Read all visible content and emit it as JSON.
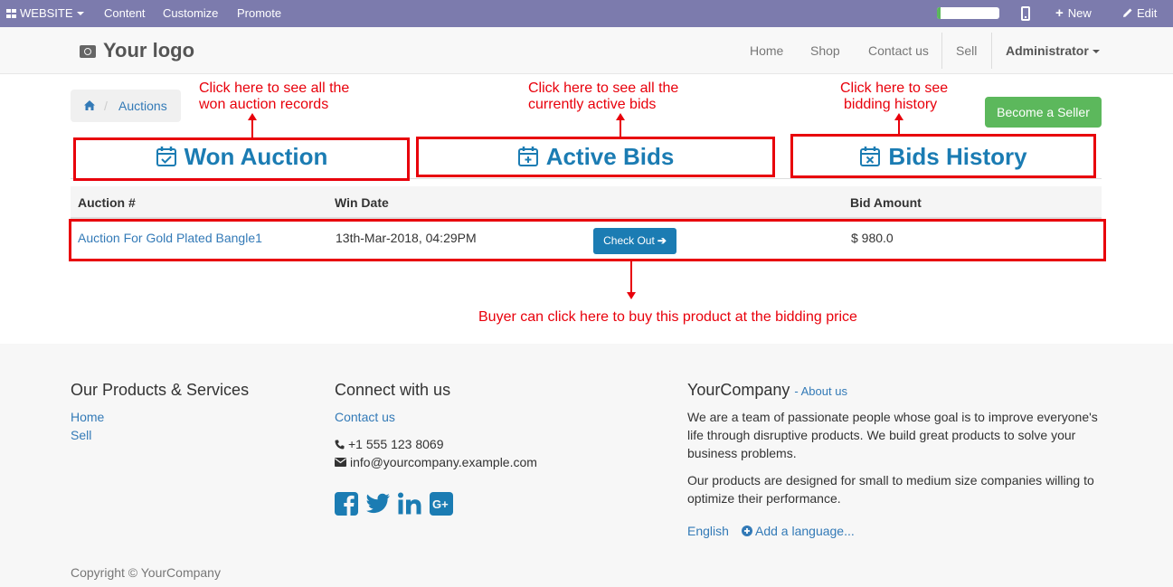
{
  "admin_bar": {
    "website_label": "WEBSITE",
    "content_label": "Content",
    "customize_label": "Customize",
    "promote_label": "Promote",
    "new_label": "New",
    "edit_label": "Edit",
    "progress_fraction": 0.06,
    "colors": {
      "background": "#7c7bad"
    }
  },
  "header": {
    "logo_text": "Your logo",
    "nav": [
      "Home",
      "Shop",
      "Contact us",
      "Sell"
    ],
    "user_label": "Administrator"
  },
  "breadcrumb": {
    "current": "Auctions"
  },
  "become_seller_label": "Become a Seller",
  "tabs": [
    {
      "label": "Won Auction",
      "icon": "calendar-check-icon"
    },
    {
      "label": "Active Bids",
      "icon": "calendar-plus-icon"
    },
    {
      "label": "Bids History",
      "icon": "calendar-times-icon"
    }
  ],
  "table": {
    "columns": [
      "Auction #",
      "Win Date",
      "Bid Amount"
    ],
    "rows": [
      {
        "auction": "Auction For Gold Plated Bangle1",
        "win_date": "13th-Mar-2018, 04:29PM",
        "action_label": "Check Out",
        "bid_amount": "$ 980.0"
      }
    ]
  },
  "annotations": {
    "won": [
      "Click here to see all the",
      "won auction records"
    ],
    "active": [
      "Click here to see all the",
      "currently active bids"
    ],
    "history": [
      "Click here to see",
      "bidding history"
    ],
    "checkout": "Buyer can click here to buy this product at the bidding price",
    "color": "#e8000b"
  },
  "footer": {
    "col1": {
      "title": "Our Products & Services",
      "links": [
        "Home",
        "Sell"
      ]
    },
    "col2": {
      "title": "Connect with us",
      "contact_link": "Contact us",
      "phone": "+1 555 123 8069",
      "email": "info@yourcompany.example.com",
      "social_icons": [
        "facebook-icon",
        "twitter-icon",
        "linkedin-icon",
        "google-plus-icon"
      ]
    },
    "col3": {
      "title": "YourCompany",
      "about_link": "- About us",
      "para1": "We are a team of passionate people whose goal is to improve everyone's life through disruptive products. We build great products to solve your business problems.",
      "para2": "Our products are designed for small to medium size companies willing to optimize their performance.",
      "language": "English",
      "add_language": "Add a language..."
    },
    "copyright": "Copyright © YourCompany"
  },
  "colors": {
    "link": "#337ab7",
    "accent": "#1b7cb3",
    "success": "#5cb85c"
  }
}
